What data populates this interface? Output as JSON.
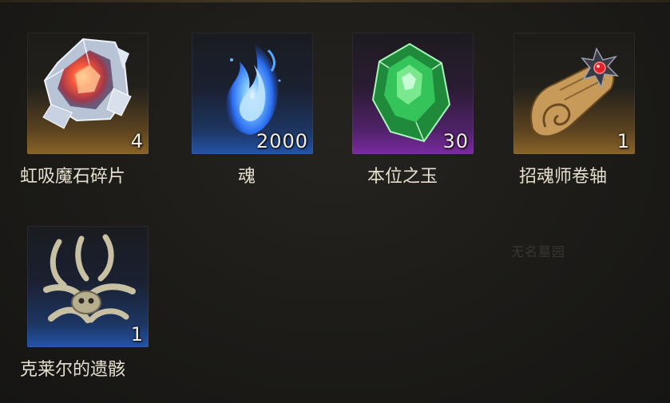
{
  "items": [
    {
      "name": "虹吸魔石碎片",
      "count": "4",
      "icon": "crystal-shard-icon",
      "rarity_color": "#8a6428"
    },
    {
      "name": "魂",
      "count": "2000",
      "icon": "blue-flame-icon",
      "rarity_color": "#2454a8"
    },
    {
      "name": "本位之玉",
      "count": "30",
      "icon": "green-gem-icon",
      "rarity_color": "#7a2aa0"
    },
    {
      "name": "招魂师卷轴",
      "count": "1",
      "icon": "scroll-icon",
      "rarity_color": "#8a6428"
    },
    {
      "name": "克莱尔的遗骸",
      "count": "1",
      "icon": "remains-icon",
      "rarity_color": "#2454a8"
    }
  ],
  "background_text": "无名墓园"
}
